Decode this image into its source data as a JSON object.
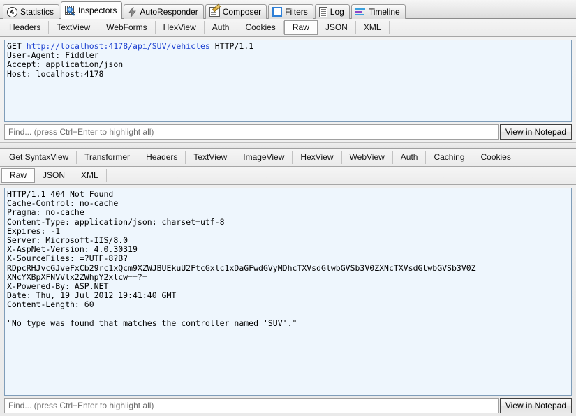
{
  "main_tabs": [
    {
      "label": "Statistics",
      "icon": "statistics-icon",
      "selected": false
    },
    {
      "label": "Inspectors",
      "icon": "inspectors-icon",
      "selected": true
    },
    {
      "label": "AutoResponder",
      "icon": "autoresponder-icon",
      "selected": false
    },
    {
      "label": "Composer",
      "icon": "composer-icon",
      "selected": false
    },
    {
      "label": "Filters",
      "icon": "filters-icon",
      "selected": false
    },
    {
      "label": "Log",
      "icon": "log-icon",
      "selected": false
    },
    {
      "label": "Timeline",
      "icon": "timeline-icon",
      "selected": false
    }
  ],
  "request": {
    "tabs": [
      {
        "label": "Headers",
        "selected": false
      },
      {
        "label": "TextView",
        "selected": false
      },
      {
        "label": "WebForms",
        "selected": false
      },
      {
        "label": "HexView",
        "selected": false
      },
      {
        "label": "Auth",
        "selected": false
      },
      {
        "label": "Cookies",
        "selected": false
      },
      {
        "label": "Raw",
        "selected": true
      },
      {
        "label": "JSON",
        "selected": false
      },
      {
        "label": "XML",
        "selected": false
      }
    ],
    "method": "GET",
    "url": "http://localhost:4178/api/SUV/vehicles",
    "version": " HTTP/1.1",
    "headers": "User-Agent: Fiddler\nAccept: application/json\nHost: localhost:4178",
    "find_placeholder": "Find... (press Ctrl+Enter to highlight all)",
    "find_value": "",
    "notepad_label": "View in Notepad"
  },
  "response": {
    "tabs_row1": [
      {
        "label": "Get SyntaxView",
        "selected": false
      },
      {
        "label": "Transformer",
        "selected": false
      },
      {
        "label": "Headers",
        "selected": false
      },
      {
        "label": "TextView",
        "selected": false
      },
      {
        "label": "ImageView",
        "selected": false
      },
      {
        "label": "HexView",
        "selected": false
      },
      {
        "label": "WebView",
        "selected": false
      },
      {
        "label": "Auth",
        "selected": false
      },
      {
        "label": "Caching",
        "selected": false
      },
      {
        "label": "Cookies",
        "selected": false
      }
    ],
    "tabs_row2": [
      {
        "label": "Raw",
        "selected": true
      },
      {
        "label": "JSON",
        "selected": false
      },
      {
        "label": "XML",
        "selected": false
      }
    ],
    "body": "HTTP/1.1 404 Not Found\nCache-Control: no-cache\nPragma: no-cache\nContent-Type: application/json; charset=utf-8\nExpires: -1\nServer: Microsoft-IIS/8.0\nX-AspNet-Version: 4.0.30319\nX-SourceFiles: =?UTF-8?B?\nRDpcRHJvcGJveFxCb29rc1xQcm9XZWJBUEkuU2FtcGxlc1xDaGFwdGVyMDhcTXVsdGlwbGVSb3V0ZXNcTXVsdGlwbGVSb3V0Z\nXNcYXBpXFNVVlx2ZWhpY2xlcw==?=\nX-Powered-By: ASP.NET\nDate: Thu, 19 Jul 2012 19:41:40 GMT\nContent-Length: 60\n\n\"No type was found that matches the controller named 'SUV'.\"",
    "find_placeholder": "Find... (press Ctrl+Enter to highlight all)",
    "find_value": "",
    "notepad_label": "View in Notepad"
  },
  "colors": {
    "pane_background": "#eef6fd",
    "pane_border": "#7f9db9",
    "link": "#1a3fd0",
    "tab_selected": "#fdfdfd"
  }
}
